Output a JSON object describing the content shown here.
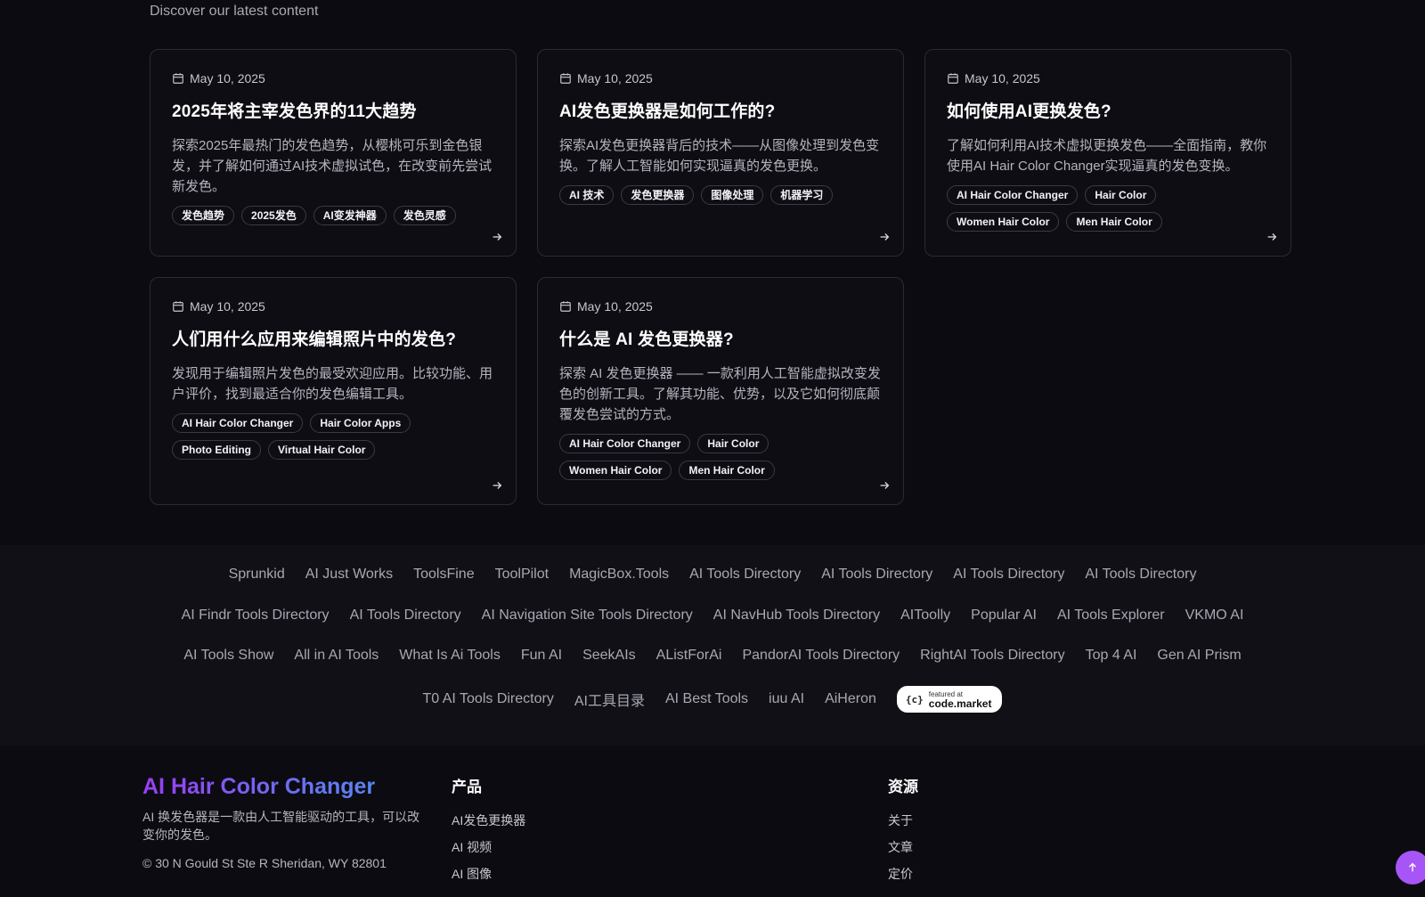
{
  "section": {
    "subtitle": "Discover our latest content"
  },
  "posts": [
    {
      "date": "May 10, 2025",
      "title": "2025年将主宰发色界的11大趋势",
      "desc": "探索2025年最热门的发色趋势，从樱桃可乐到金色银发，并了解如何通过AI技术虚拟试色，在改变前先尝试新发色。",
      "tags": [
        "发色趋势",
        "2025发色",
        "AI变发神器",
        "发色灵感"
      ]
    },
    {
      "date": "May 10, 2025",
      "title": "AI发色更换器是如何工作的?",
      "desc": "探索AI发色更换器背后的技术——从图像处理到发色变换。了解人工智能如何实现逼真的发色更换。",
      "tags": [
        "AI 技术",
        "发色更换器",
        "图像处理",
        "机器学习"
      ]
    },
    {
      "date": "May 10, 2025",
      "title": "如何使用AI更换发色?",
      "desc": "了解如何利用AI技术虚拟更换发色——全面指南，教你使用AI Hair Color Changer实现逼真的发色变换。",
      "tags": [
        "AI Hair Color Changer",
        "Hair Color",
        "Women Hair Color",
        "Men Hair Color"
      ]
    },
    {
      "date": "May 10, 2025",
      "title": "人们用什么应用来编辑照片中的发色?",
      "desc": "发现用于编辑照片发色的最受欢迎应用。比较功能、用户评价，找到最适合你的发色编辑工具。",
      "tags": [
        "AI Hair Color Changer",
        "Hair Color Apps",
        "Photo Editing",
        "Virtual Hair Color"
      ]
    },
    {
      "date": "May 10, 2025",
      "title": "什么是 AI 发色更换器?",
      "desc": "探索 AI 发色更换器 —— 一款利用人工智能虚拟改变发色的创新工具。了解其功能、优势，以及它如何彻底颠覆发色尝试的方式。",
      "tags": [
        "AI Hair Color Changer",
        "Hair Color",
        "Women Hair Color",
        "Men Hair Color"
      ]
    }
  ],
  "partner_links": {
    "row1": [
      "Sprunkid",
      "AI Just Works",
      "ToolsFine",
      "ToolPilot",
      "MagicBox.Tools",
      "AI Tools Directory",
      "AI Tools Directory",
      "AI Tools Directory",
      "AI Tools Directory"
    ],
    "row2": [
      "AI Findr Tools Directory",
      "AI Tools Directory",
      "AI Navigation Site Tools Directory",
      "AI NavHub Tools Directory",
      "AIToolly",
      "Popular AI",
      "AI Tools Explorer",
      "VKMO AI"
    ],
    "row3": [
      "AI Tools Show",
      "All in AI Tools",
      "What Is Ai Tools",
      "Fun AI",
      "SeekAIs",
      "AListForAi",
      "PandorAI Tools Directory",
      "RightAI Tools Directory",
      "Top 4 AI",
      "Gen AI Prism"
    ],
    "row4": [
      "T0 AI Tools Directory",
      "AI工具目录",
      "AI Best Tools",
      "iuu AI",
      "AiHeron"
    ],
    "badge": {
      "small": "featured at",
      "big": "code.market",
      "icon": "{c}"
    }
  },
  "footer": {
    "brand": "AI Hair Color Changer",
    "desc": "AI 换发色器是一款由人工智能驱动的工具，可以改变你的发色。",
    "address": "© 30 N Gould St Ste R Sheridan, WY 82801",
    "products": {
      "title": "产品",
      "items": [
        "AI发色更换器",
        "AI 视频",
        "AI 图像"
      ]
    },
    "resources": {
      "title": "资源",
      "items": [
        "关于",
        "文章",
        "定价"
      ]
    }
  },
  "colors": {
    "accent": "#a855f7",
    "background": "#0c0b12"
  },
  "icons": {
    "date": "calendar-icon",
    "card_link": "arrow-right-icon",
    "scroll_top": "arrow-up-icon"
  }
}
